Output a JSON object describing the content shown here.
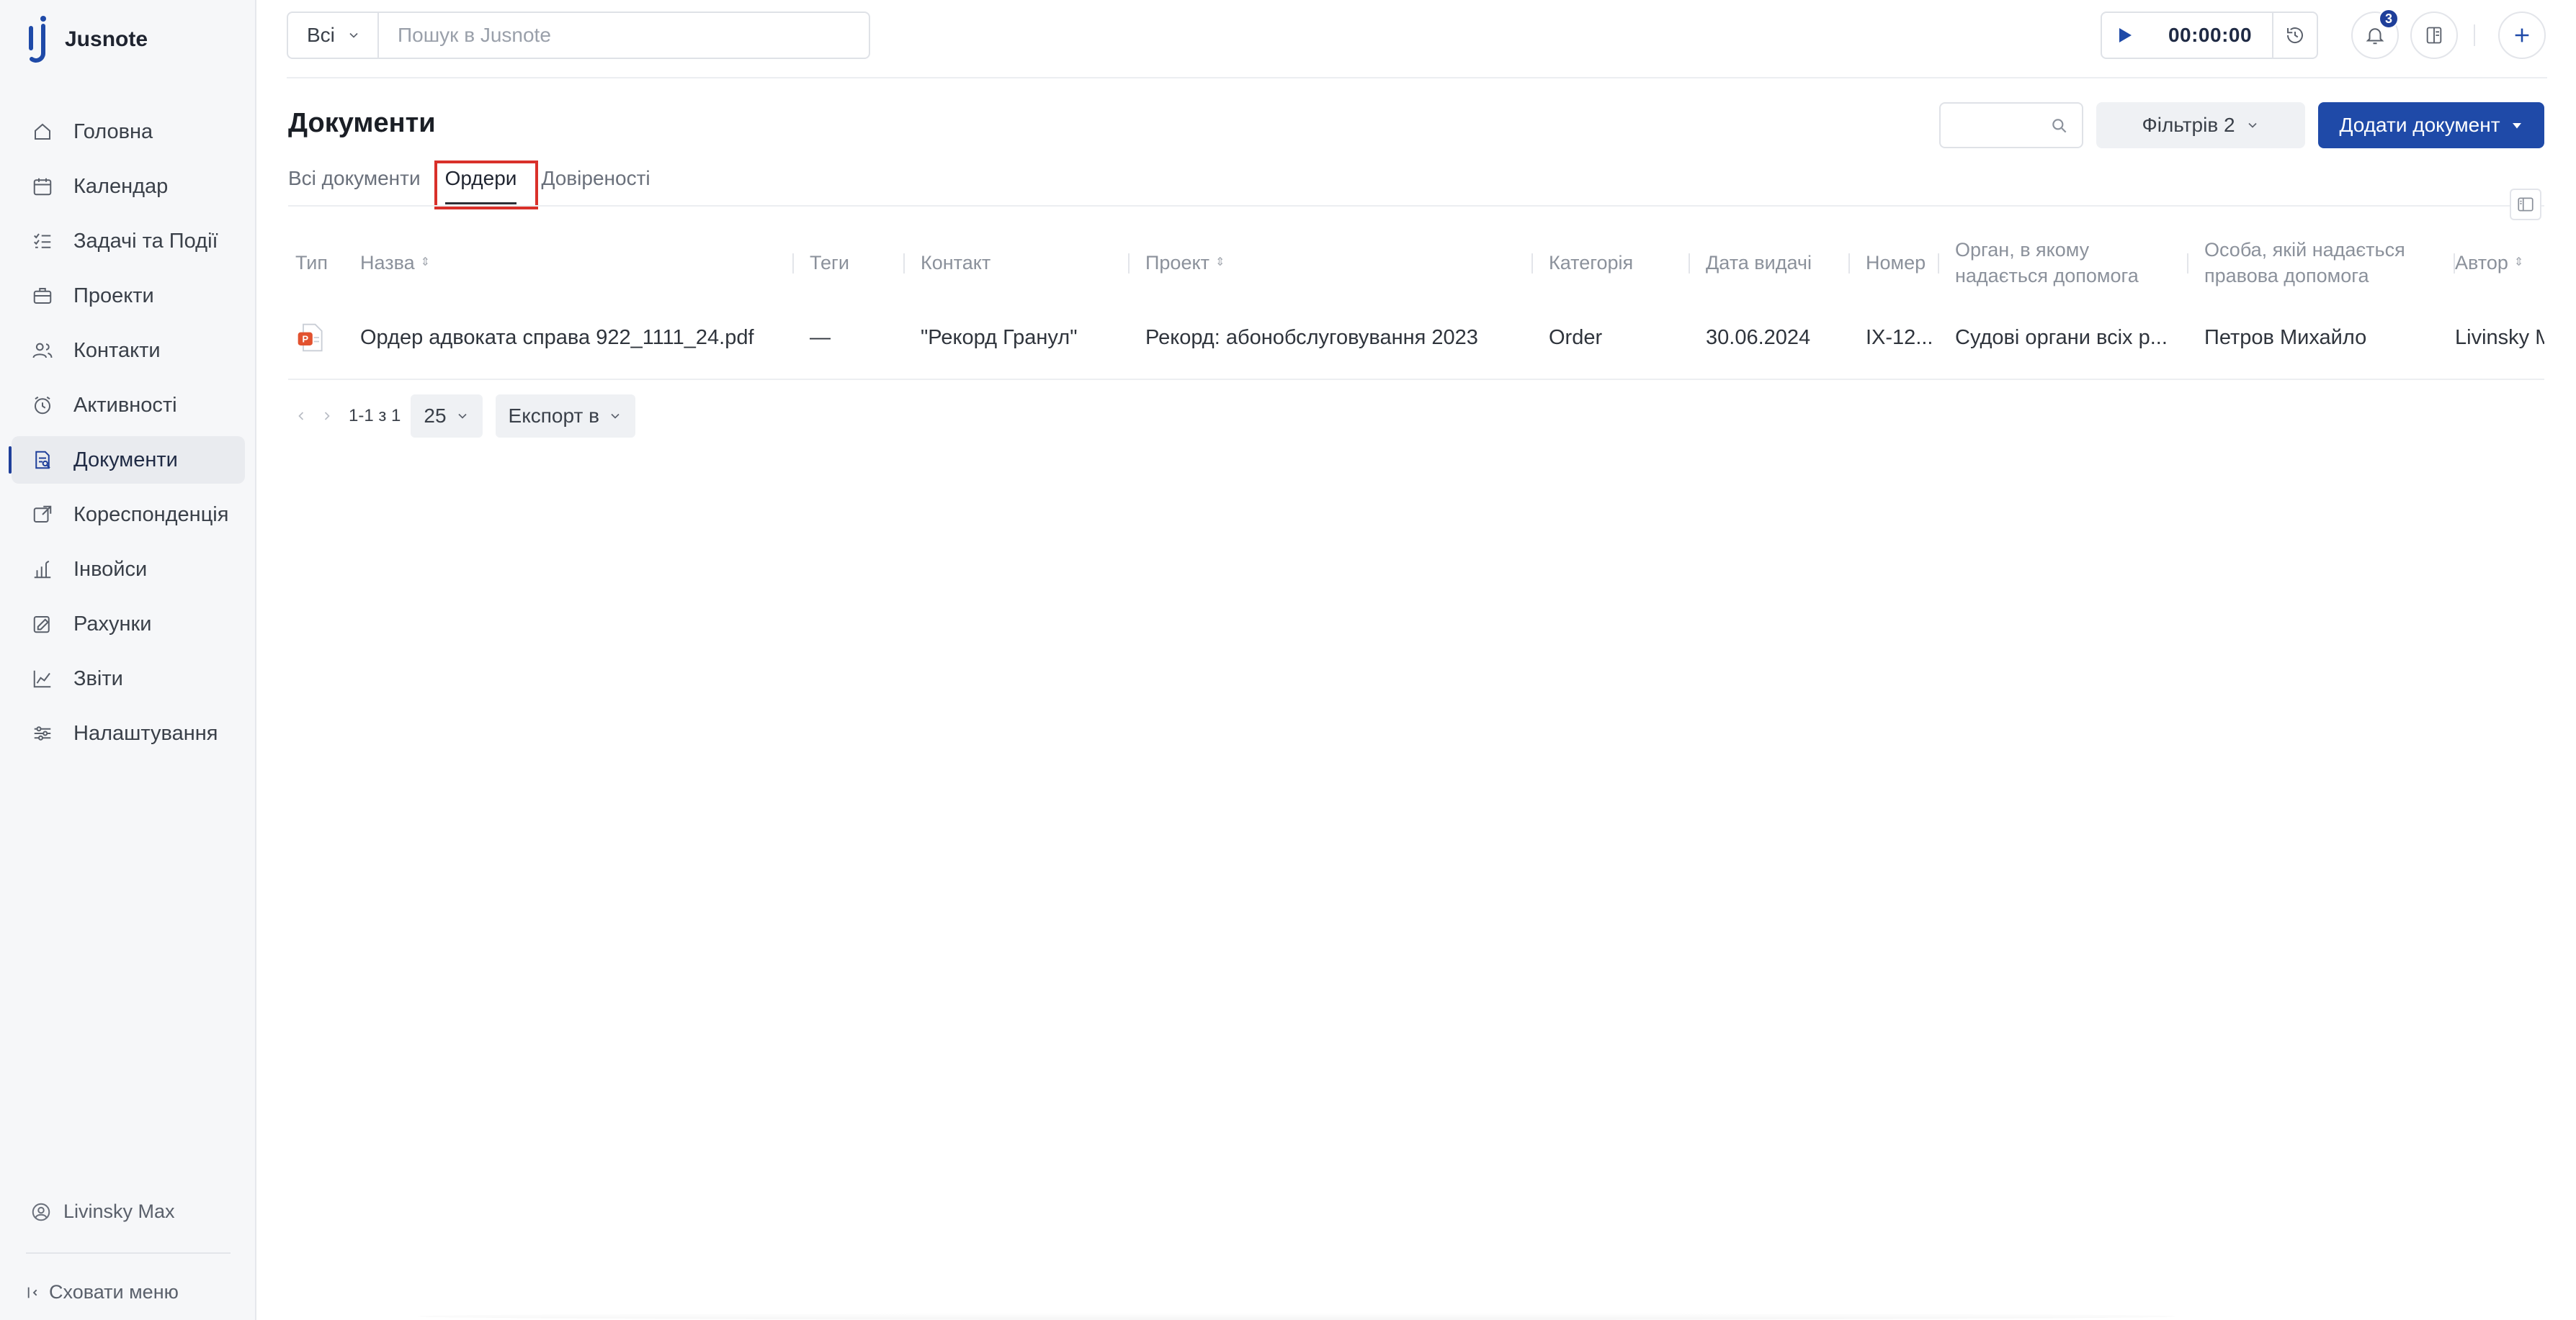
{
  "app": {
    "name": "Jusnote"
  },
  "colors": {
    "brand": "#1f4aa8",
    "highlight": "#d9302a",
    "badge": "#1f3f9a"
  },
  "sidebar": {
    "items": [
      {
        "label": "Головна",
        "icon": "home-icon"
      },
      {
        "label": "Календар",
        "icon": "calendar-icon"
      },
      {
        "label": "Задачі та Події",
        "icon": "tasks-icon"
      },
      {
        "label": "Проекти",
        "icon": "briefcase-icon"
      },
      {
        "label": "Контакти",
        "icon": "contacts-icon"
      },
      {
        "label": "Активності",
        "icon": "clock-icon"
      },
      {
        "label": "Документи",
        "icon": "documents-icon",
        "active": true
      },
      {
        "label": "Кореспонденція",
        "icon": "correspondence-icon"
      },
      {
        "label": "Інвойси",
        "icon": "invoice-icon"
      },
      {
        "label": "Рахунки",
        "icon": "bills-icon"
      },
      {
        "label": "Звіти",
        "icon": "reports-icon"
      },
      {
        "label": "Налаштування",
        "icon": "settings-icon"
      }
    ],
    "user": "Livinsky Max",
    "hide_menu": "Сховати меню"
  },
  "topbar": {
    "scope": "Всі",
    "search_placeholder": "Пошук в Jusnote",
    "timer": "00:00:00",
    "notifications_count": "3"
  },
  "main": {
    "title": "Документи",
    "filters_label": "Фільтрів 2",
    "add_label": "Додати документ",
    "tabs": [
      {
        "label": "Всі документи"
      },
      {
        "label": "Ордери",
        "active": true
      },
      {
        "label": "Довіреності"
      }
    ]
  },
  "table": {
    "columns": [
      {
        "label": "Тип"
      },
      {
        "label": "Назва",
        "sortable": true
      },
      {
        "label": "Теги"
      },
      {
        "label": "Контакт"
      },
      {
        "label": "Проект",
        "sortable": true
      },
      {
        "label": "Категорія"
      },
      {
        "label": "Дата видачі"
      },
      {
        "label": "Номер"
      },
      {
        "label": "Орган, в якому надається допомога"
      },
      {
        "label": "Особа, якій надається правова допомога"
      },
      {
        "label": "Автор",
        "sortable": true
      }
    ],
    "rows": [
      {
        "type_icon": "pdf-icon",
        "name": "Ордер адвоката справа 922_1111_24.pdf",
        "tags": "—",
        "contact": "\"Рекорд Гранул\"",
        "project": "Рекорд: абонобслуговування 2023",
        "category": "Order",
        "issue_date": "30.06.2024",
        "number": "IX-12...",
        "authority": "Судові органи всіх р...",
        "person": "Петров Михайло",
        "author": "Livinsky M"
      }
    ]
  },
  "pagination": {
    "range": "1-1 з 1",
    "page_size": "25",
    "export_label": "Експорт в"
  }
}
